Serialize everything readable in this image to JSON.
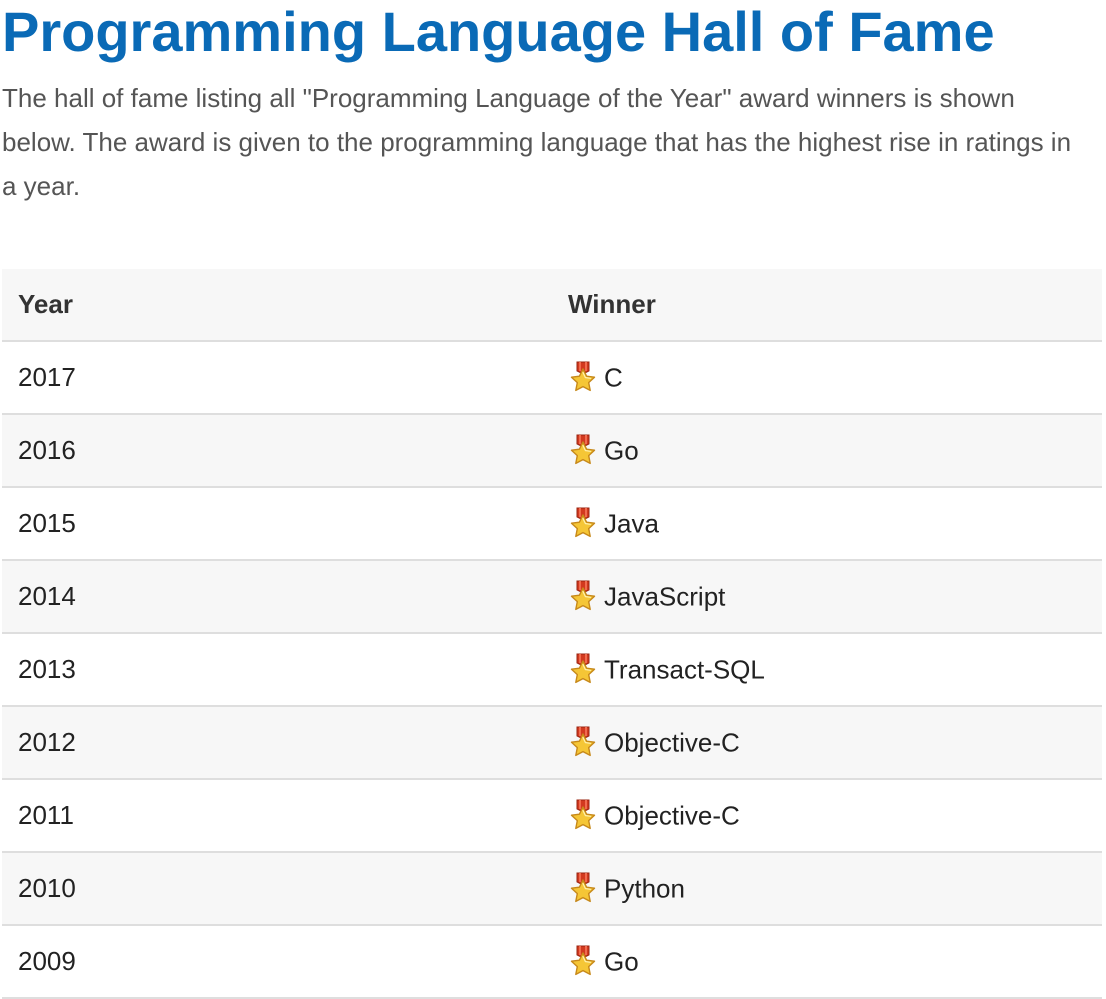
{
  "page": {
    "title": "Programming Language Hall of Fame",
    "intro": "The hall of fame listing all \"Programming Language of the Year\" award winners is shown below. The award is given to the programming language that has the highest rise in ratings in a year."
  },
  "table": {
    "headers": {
      "year": "Year",
      "winner": "Winner"
    },
    "rows": [
      {
        "year": "2017",
        "winner": "C",
        "icon": "award-medal-icon"
      },
      {
        "year": "2016",
        "winner": "Go",
        "icon": "award-medal-icon"
      },
      {
        "year": "2015",
        "winner": "Java",
        "icon": "award-medal-icon"
      },
      {
        "year": "2014",
        "winner": "JavaScript",
        "icon": "award-medal-icon"
      },
      {
        "year": "2013",
        "winner": "Transact-SQL",
        "icon": "award-medal-icon"
      },
      {
        "year": "2012",
        "winner": "Objective-C",
        "icon": "award-medal-icon"
      },
      {
        "year": "2011",
        "winner": "Objective-C",
        "icon": "award-medal-icon"
      },
      {
        "year": "2010",
        "winner": "Python",
        "icon": "award-medal-icon"
      },
      {
        "year": "2009",
        "winner": "Go",
        "icon": "award-medal-icon"
      }
    ]
  },
  "colors": {
    "title": "#0a6ab6",
    "header_bg": "#f7f7f7",
    "stripe_bg": "#f7f7f7",
    "border": "#dedede"
  }
}
